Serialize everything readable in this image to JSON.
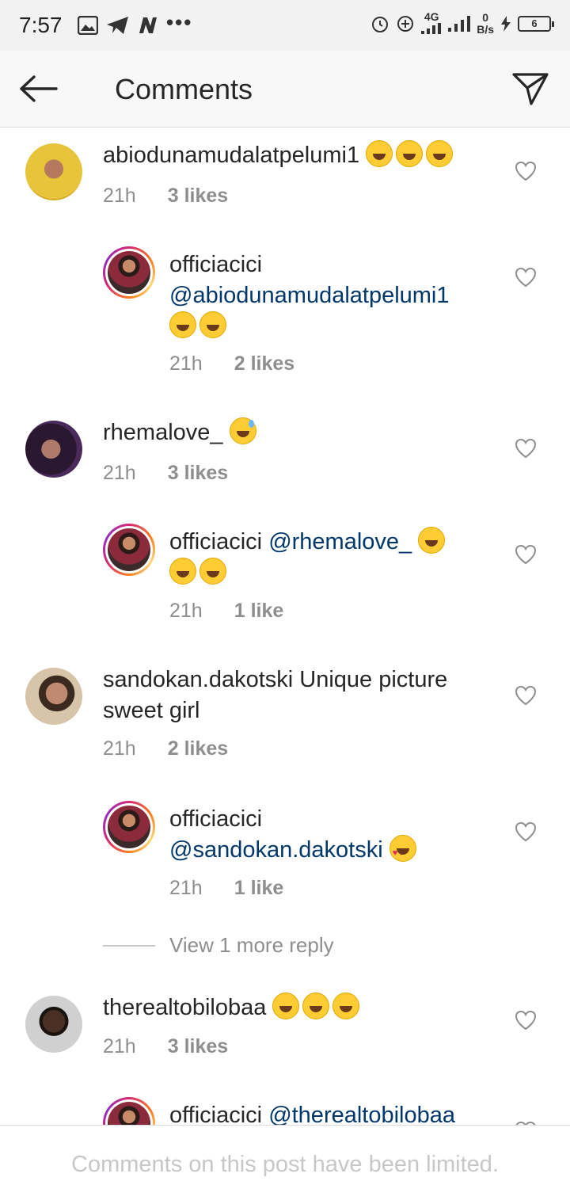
{
  "status_bar": {
    "time": "7:57",
    "left_icons": [
      "gallery-icon",
      "telegram-icon",
      "n-icon"
    ],
    "more": "•••",
    "network": "4G",
    "speed_value": "0",
    "speed_unit": "B/s",
    "battery": "6"
  },
  "header": {
    "title": "Comments",
    "back_icon": "back-arrow-icon",
    "send_icon": "direct-send-icon"
  },
  "comments": [
    {
      "username": "abiodunamudalatpelumi1",
      "text": "",
      "emojis": [
        "laugh",
        "laugh",
        "laugh"
      ],
      "time": "21h",
      "likes": "3 likes",
      "reply": false
    },
    {
      "username": "officiacici",
      "mention": "@abiodunamudalatpelumi1",
      "text": "",
      "emojis": [
        "laugh",
        "laugh"
      ],
      "time": "21h",
      "likes": "2 likes",
      "reply": true
    },
    {
      "username": "rhemalove_",
      "text": "",
      "emojis": [
        "sweat"
      ],
      "time": "21h",
      "likes": "3 likes",
      "reply": false
    },
    {
      "username": "officiacici",
      "mention": "@rhemalove_",
      "text": "",
      "emojis": [
        "laugh",
        "laugh",
        "laugh"
      ],
      "time": "21h",
      "likes": "1 like",
      "reply": true
    },
    {
      "username": "sandokan.dakotski",
      "text": "Unique picture sweet girl",
      "emojis": [],
      "time": "21h",
      "likes": "2 likes",
      "reply": false
    },
    {
      "username": "officiacici",
      "mention": "@sandokan.dakotski",
      "text": "",
      "emojis": [
        "love"
      ],
      "time": "21h",
      "likes": "1 like",
      "reply": true
    },
    {
      "username": "therealtobilobaa",
      "text": "",
      "emojis": [
        "laugh",
        "laugh",
        "laugh"
      ],
      "time": "21h",
      "likes": "3 likes",
      "reply": false
    },
    {
      "username": "officiacici",
      "mention": "@therealtobilobaa",
      "text": "",
      "emojis": [],
      "time": "",
      "likes": "",
      "reply": true
    }
  ],
  "view_more": "View 1 more reply",
  "footer": {
    "notice": "Comments on this post have been limited."
  },
  "colors": {
    "mention": "#00376b",
    "meta": "#8e8e8e",
    "footer_text": "#c7c7c7"
  }
}
